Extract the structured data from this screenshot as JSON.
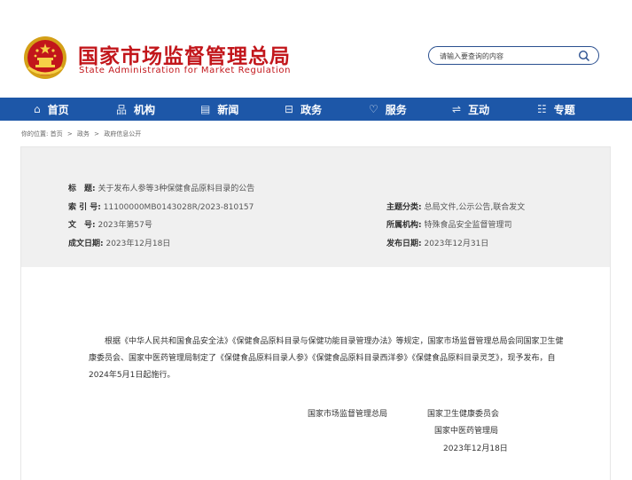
{
  "header": {
    "title_cn": "国家市场监督管理总局",
    "title_en": "State Administration for Market Regulation"
  },
  "search": {
    "placeholder": "请输入要查询的内容",
    "icon": "search-icon"
  },
  "nav": {
    "items": [
      {
        "label": "首页",
        "icon": "home-icon",
        "glyph": "⌂"
      },
      {
        "label": "机构",
        "icon": "org-chart-icon",
        "glyph": "品"
      },
      {
        "label": "新闻",
        "icon": "news-icon",
        "glyph": "▤"
      },
      {
        "label": "政务",
        "icon": "government-affairs-icon",
        "glyph": "⊟"
      },
      {
        "label": "服务",
        "icon": "heart-icon",
        "glyph": "♡"
      },
      {
        "label": "互动",
        "icon": "exchange-icon",
        "glyph": "⇌"
      },
      {
        "label": "专题",
        "icon": "topics-icon",
        "glyph": "☷"
      }
    ],
    "bg_color": "#1d57a8"
  },
  "breadcrumb": {
    "prefix": "你的位置:",
    "items": [
      "首页",
      "政务",
      "政府信息公开"
    ],
    "separator": ">"
  },
  "meta": {
    "title_label": "标　题:",
    "title_value": "关于发布人参等3种保健食品原料目录的公告",
    "index_label": "索 引 号:",
    "index_value": "11100000MB0143028R/2023-810157",
    "docno_label": "文　号:",
    "docno_value": "2023年第57号",
    "date_label": "成文日期:",
    "date_value": "2023年12月18日",
    "category_label": "主题分类:",
    "category_value": "总局文件,公示公告,联合发文",
    "org_label": "所属机构:",
    "org_value": "特殊食品安全监督管理司",
    "pubdate_label": "发布日期:",
    "pubdate_value": "2023年12月31日"
  },
  "article": {
    "body": "根据《中华人民共和国食品安全法》《保健食品原料目录与保健功能目录管理办法》等规定，国家市场监督管理总局会同国家卫生健康委员会、国家中医药管理局制定了《保健食品原料目录人参》《保健食品原料目录西洋参》《保健食品原料目录灵芝》，现予发布，自2024年5月1日起施行。",
    "sig1": "国家市场监督管理总局",
    "sig2": "国家卫生健康委员会",
    "sig3": "国家中医药管理局",
    "sig_date": "2023年12月18日"
  },
  "colors": {
    "brand_red": "#c2161b",
    "nav_blue": "#1d57a8",
    "meta_bg": "#f0f0f0"
  }
}
